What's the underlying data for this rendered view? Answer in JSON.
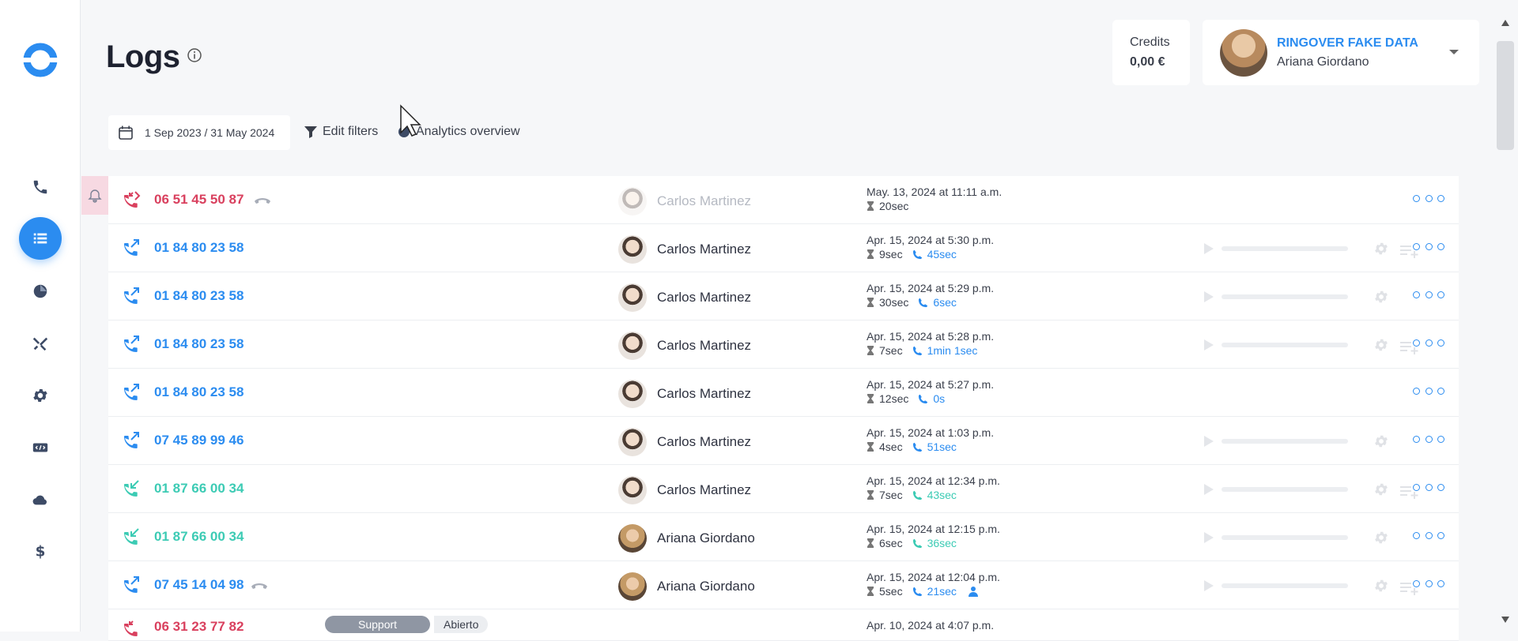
{
  "header": {
    "title": "Logs",
    "credits_label": "Credits",
    "credits_value": "0,00 €",
    "company": "RINGOVER FAKE DATA",
    "user": "Ariana Giordano"
  },
  "toolbar": {
    "date_range": "1 Sep 2023 / 31 May 2024",
    "edit_filters": "Edit filters",
    "analytics": "Analytics overview"
  },
  "sidebar": {
    "items": [
      "phone-icon",
      "logs-icon",
      "analytics-icon",
      "tools-icon",
      "settings-icon",
      "api-icon",
      "cloud-icon",
      "billing-icon"
    ],
    "active": "logs-icon"
  },
  "colors": {
    "accent": "#2b8cf0",
    "missed": "#d9405e",
    "inbound": "#3ccbb4"
  },
  "logs": [
    {
      "number": "06 51 45 50 87",
      "agent": "Carlos Martinez",
      "date": "May. 13, 2024 at 11:11 a.m.",
      "duration": "20sec",
      "talk": ""
    },
    {
      "number": "01 84 80 23 58",
      "agent": "Carlos Martinez",
      "date": "Apr. 15, 2024 at 5:30 p.m.",
      "duration": "9sec",
      "talk": "45sec"
    },
    {
      "number": "01 84 80 23 58",
      "agent": "Carlos Martinez",
      "date": "Apr. 15, 2024 at 5:29 p.m.",
      "duration": "30sec",
      "talk": "6sec"
    },
    {
      "number": "01 84 80 23 58",
      "agent": "Carlos Martinez",
      "date": "Apr. 15, 2024 at 5:28 p.m.",
      "duration": "7sec",
      "talk": "1min 1sec"
    },
    {
      "number": "01 84 80 23 58",
      "agent": "Carlos Martinez",
      "date": "Apr. 15, 2024 at 5:27 p.m.",
      "duration": "12sec",
      "talk": "0s"
    },
    {
      "number": "07 45 89 99 46",
      "agent": "Carlos Martinez",
      "date": "Apr. 15, 2024 at 1:03 p.m.",
      "duration": "4sec",
      "talk": "51sec"
    },
    {
      "number": "01 87 66 00 34",
      "agent": "Carlos Martinez",
      "date": "Apr. 15, 2024 at 12:34 p.m.",
      "duration": "7sec",
      "talk": "43sec"
    },
    {
      "number": "01 87 66 00 34",
      "agent": "Ariana Giordano",
      "date": "Apr. 15, 2024 at 12:15 p.m.",
      "duration": "6sec",
      "talk": "36sec"
    },
    {
      "number": "07 45 14 04 98",
      "agent": "Ariana Giordano",
      "date": "Apr. 15, 2024 at 12:04 p.m.",
      "duration": "5sec",
      "talk": "21sec"
    },
    {
      "number": "06 31 23 77 82",
      "agent": "",
      "date": "Apr. 10, 2024 at 4:07 p.m.",
      "duration": "",
      "talk": "",
      "tag": "Support",
      "tag_status": "Abierto"
    }
  ]
}
